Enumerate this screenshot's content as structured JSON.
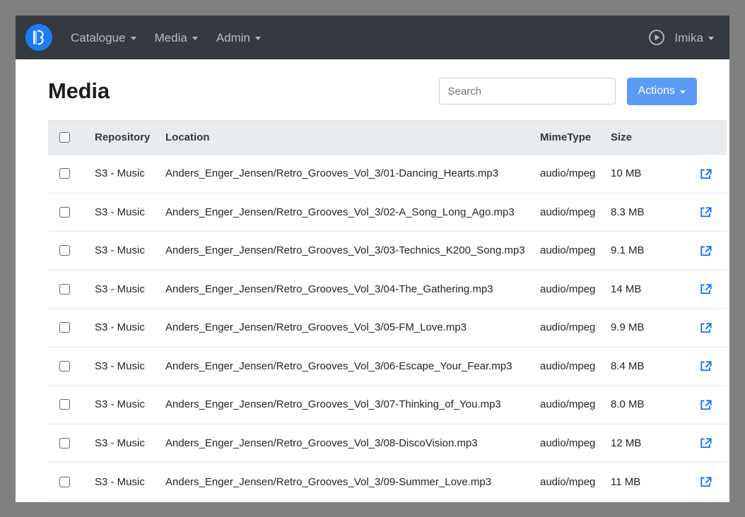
{
  "navbar": {
    "brand": {
      "icon": "alto-clef-logo-icon",
      "color": "#1a7df5"
    },
    "items": [
      {
        "label": "Catalogue",
        "has_caret": true
      },
      {
        "label": "Media",
        "has_caret": true
      },
      {
        "label": "Admin",
        "has_caret": true
      }
    ],
    "right": {
      "play_icon": "play-circle-icon",
      "user": "Imika",
      "user_has_caret": true
    }
  },
  "page": {
    "title": "Media"
  },
  "search": {
    "placeholder": "Search",
    "value": ""
  },
  "toolbar": {
    "actions_label": "Actions",
    "actions_color": "#5b9bf8"
  },
  "table": {
    "select_all_checkbox": "unchecked",
    "columns": [
      "Repository",
      "Location",
      "MimeType",
      "Size"
    ],
    "rows": [
      {
        "checked": false,
        "repository": "S3 - Music",
        "location": "Anders_Enger_Jensen/Retro_Grooves_Vol_3/01-Dancing_Hearts.mp3",
        "mimetype": "audio/mpeg",
        "size": "10 MB",
        "action_icon": "external-link-icon"
      },
      {
        "checked": false,
        "repository": "S3 - Music",
        "location": "Anders_Enger_Jensen/Retro_Grooves_Vol_3/02-A_Song_Long_Ago.mp3",
        "mimetype": "audio/mpeg",
        "size": "8.3 MB",
        "action_icon": "external-link-icon"
      },
      {
        "checked": false,
        "repository": "S3 - Music",
        "location": "Anders_Enger_Jensen/Retro_Grooves_Vol_3/03-Technics_K200_Song.mp3",
        "mimetype": "audio/mpeg",
        "size": "9.1 MB",
        "action_icon": "external-link-icon"
      },
      {
        "checked": false,
        "repository": "S3 - Music",
        "location": "Anders_Enger_Jensen/Retro_Grooves_Vol_3/04-The_Gathering.mp3",
        "mimetype": "audio/mpeg",
        "size": "14 MB",
        "action_icon": "external-link-icon"
      },
      {
        "checked": false,
        "repository": "S3 - Music",
        "location": "Anders_Enger_Jensen/Retro_Grooves_Vol_3/05-FM_Love.mp3",
        "mimetype": "audio/mpeg",
        "size": "9.9 MB",
        "action_icon": "external-link-icon"
      },
      {
        "checked": false,
        "repository": "S3 - Music",
        "location": "Anders_Enger_Jensen/Retro_Grooves_Vol_3/06-Escape_Your_Fear.mp3",
        "mimetype": "audio/mpeg",
        "size": "8.4 MB",
        "action_icon": "external-link-icon"
      },
      {
        "checked": false,
        "repository": "S3 - Music",
        "location": "Anders_Enger_Jensen/Retro_Grooves_Vol_3/07-Thinking_of_You.mp3",
        "mimetype": "audio/mpeg",
        "size": "8.0 MB",
        "action_icon": "external-link-icon"
      },
      {
        "checked": false,
        "repository": "S3 - Music",
        "location": "Anders_Enger_Jensen/Retro_Grooves_Vol_3/08-DiscoVision.mp3",
        "mimetype": "audio/mpeg",
        "size": "12 MB",
        "action_icon": "external-link-icon"
      },
      {
        "checked": false,
        "repository": "S3 - Music",
        "location": "Anders_Enger_Jensen/Retro_Grooves_Vol_3/09-Summer_Love.mp3",
        "mimetype": "audio/mpeg",
        "size": "11 MB",
        "action_icon": "external-link-icon"
      }
    ]
  }
}
